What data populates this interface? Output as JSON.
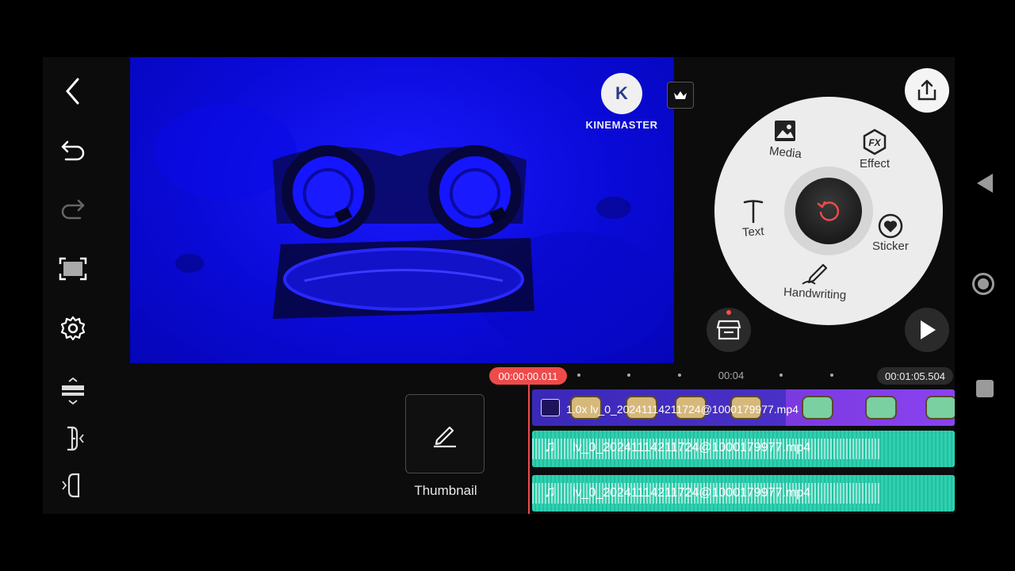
{
  "watermark": {
    "logo_letter": "K",
    "text": "KINEMASTER"
  },
  "wheel": {
    "media": "Media",
    "effect": "Effect",
    "text": "Text",
    "sticker": "Sticker",
    "handwriting": "Handwriting"
  },
  "timeline": {
    "current_time": "00:00:00.011",
    "mid_time": "00:04",
    "total_time": "00:01:05.504",
    "video_clip_label": "1.0x lv_0_20241114211724@1000179977.mp4",
    "audio_tracks": [
      {
        "label": "lv_0_20241114211724@1000179977.mp4"
      },
      {
        "label": "lv_0_20241114211724@1000179977.mp4"
      }
    ]
  },
  "thumbnail": {
    "label": "Thumbnail"
  },
  "icons": {
    "audio_glyph": "♫"
  },
  "colors": {
    "accent": "#ee4a4a",
    "audio_track": "#2fd0b0",
    "video_track": "#4a30c6"
  }
}
